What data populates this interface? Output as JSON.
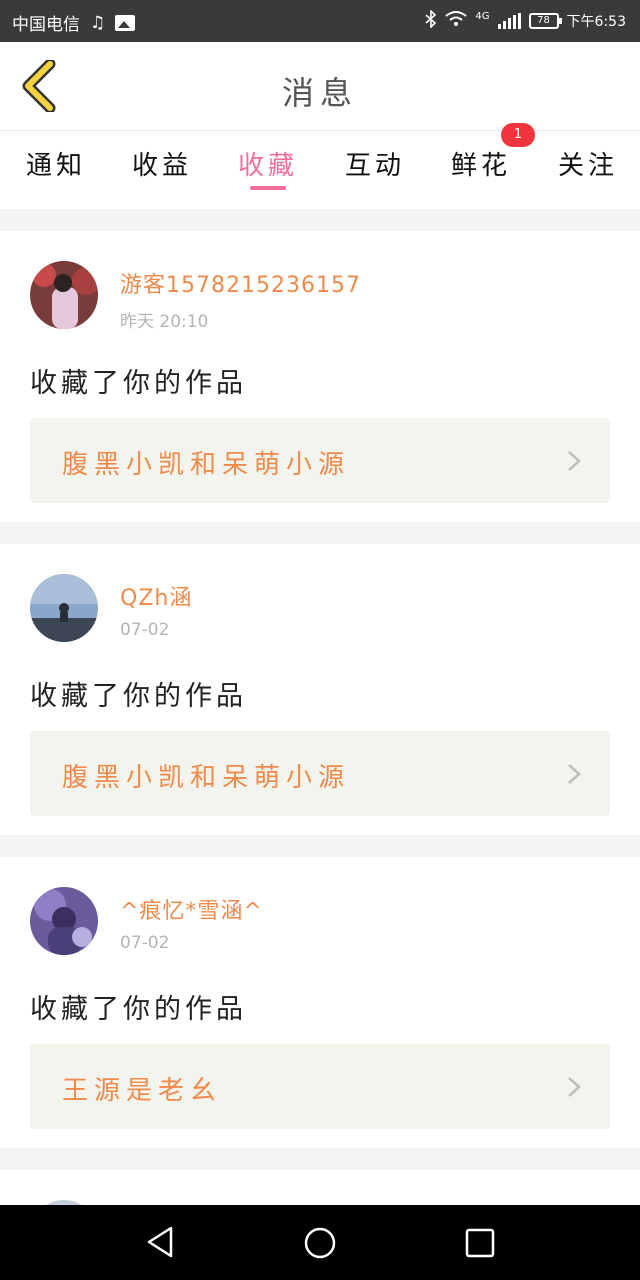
{
  "status_bar": {
    "carrier": "中国电信",
    "music_glyph": "♫",
    "network": "4G",
    "battery": "78",
    "time": "下午6:53"
  },
  "header": {
    "title": "消息"
  },
  "tabs": [
    {
      "label": "通知"
    },
    {
      "label": "收益"
    },
    {
      "label": "收藏"
    },
    {
      "label": "互动"
    },
    {
      "label": "鲜花",
      "badge": "1"
    },
    {
      "label": "关注"
    }
  ],
  "active_tab": "收藏",
  "messages": [
    {
      "user": "游客1578215236157",
      "time": "昨天 20:10",
      "action": "收藏了你的作品",
      "work": "腹黑小凯和呆萌小源"
    },
    {
      "user": "QZh涵",
      "time": "07-02",
      "action": "收藏了你的作品",
      "work": "腹黑小凯和呆萌小源"
    },
    {
      "user": "^痕忆*雪涵^",
      "time": "07-02",
      "action": "收藏了你的作品",
      "work": "王源是老幺"
    }
  ],
  "colors": {
    "accent_pink": "#f0709b",
    "name_orange": "#f08a4b",
    "badge_red": "#f2343c",
    "back_yellow": "#f5d33c"
  }
}
